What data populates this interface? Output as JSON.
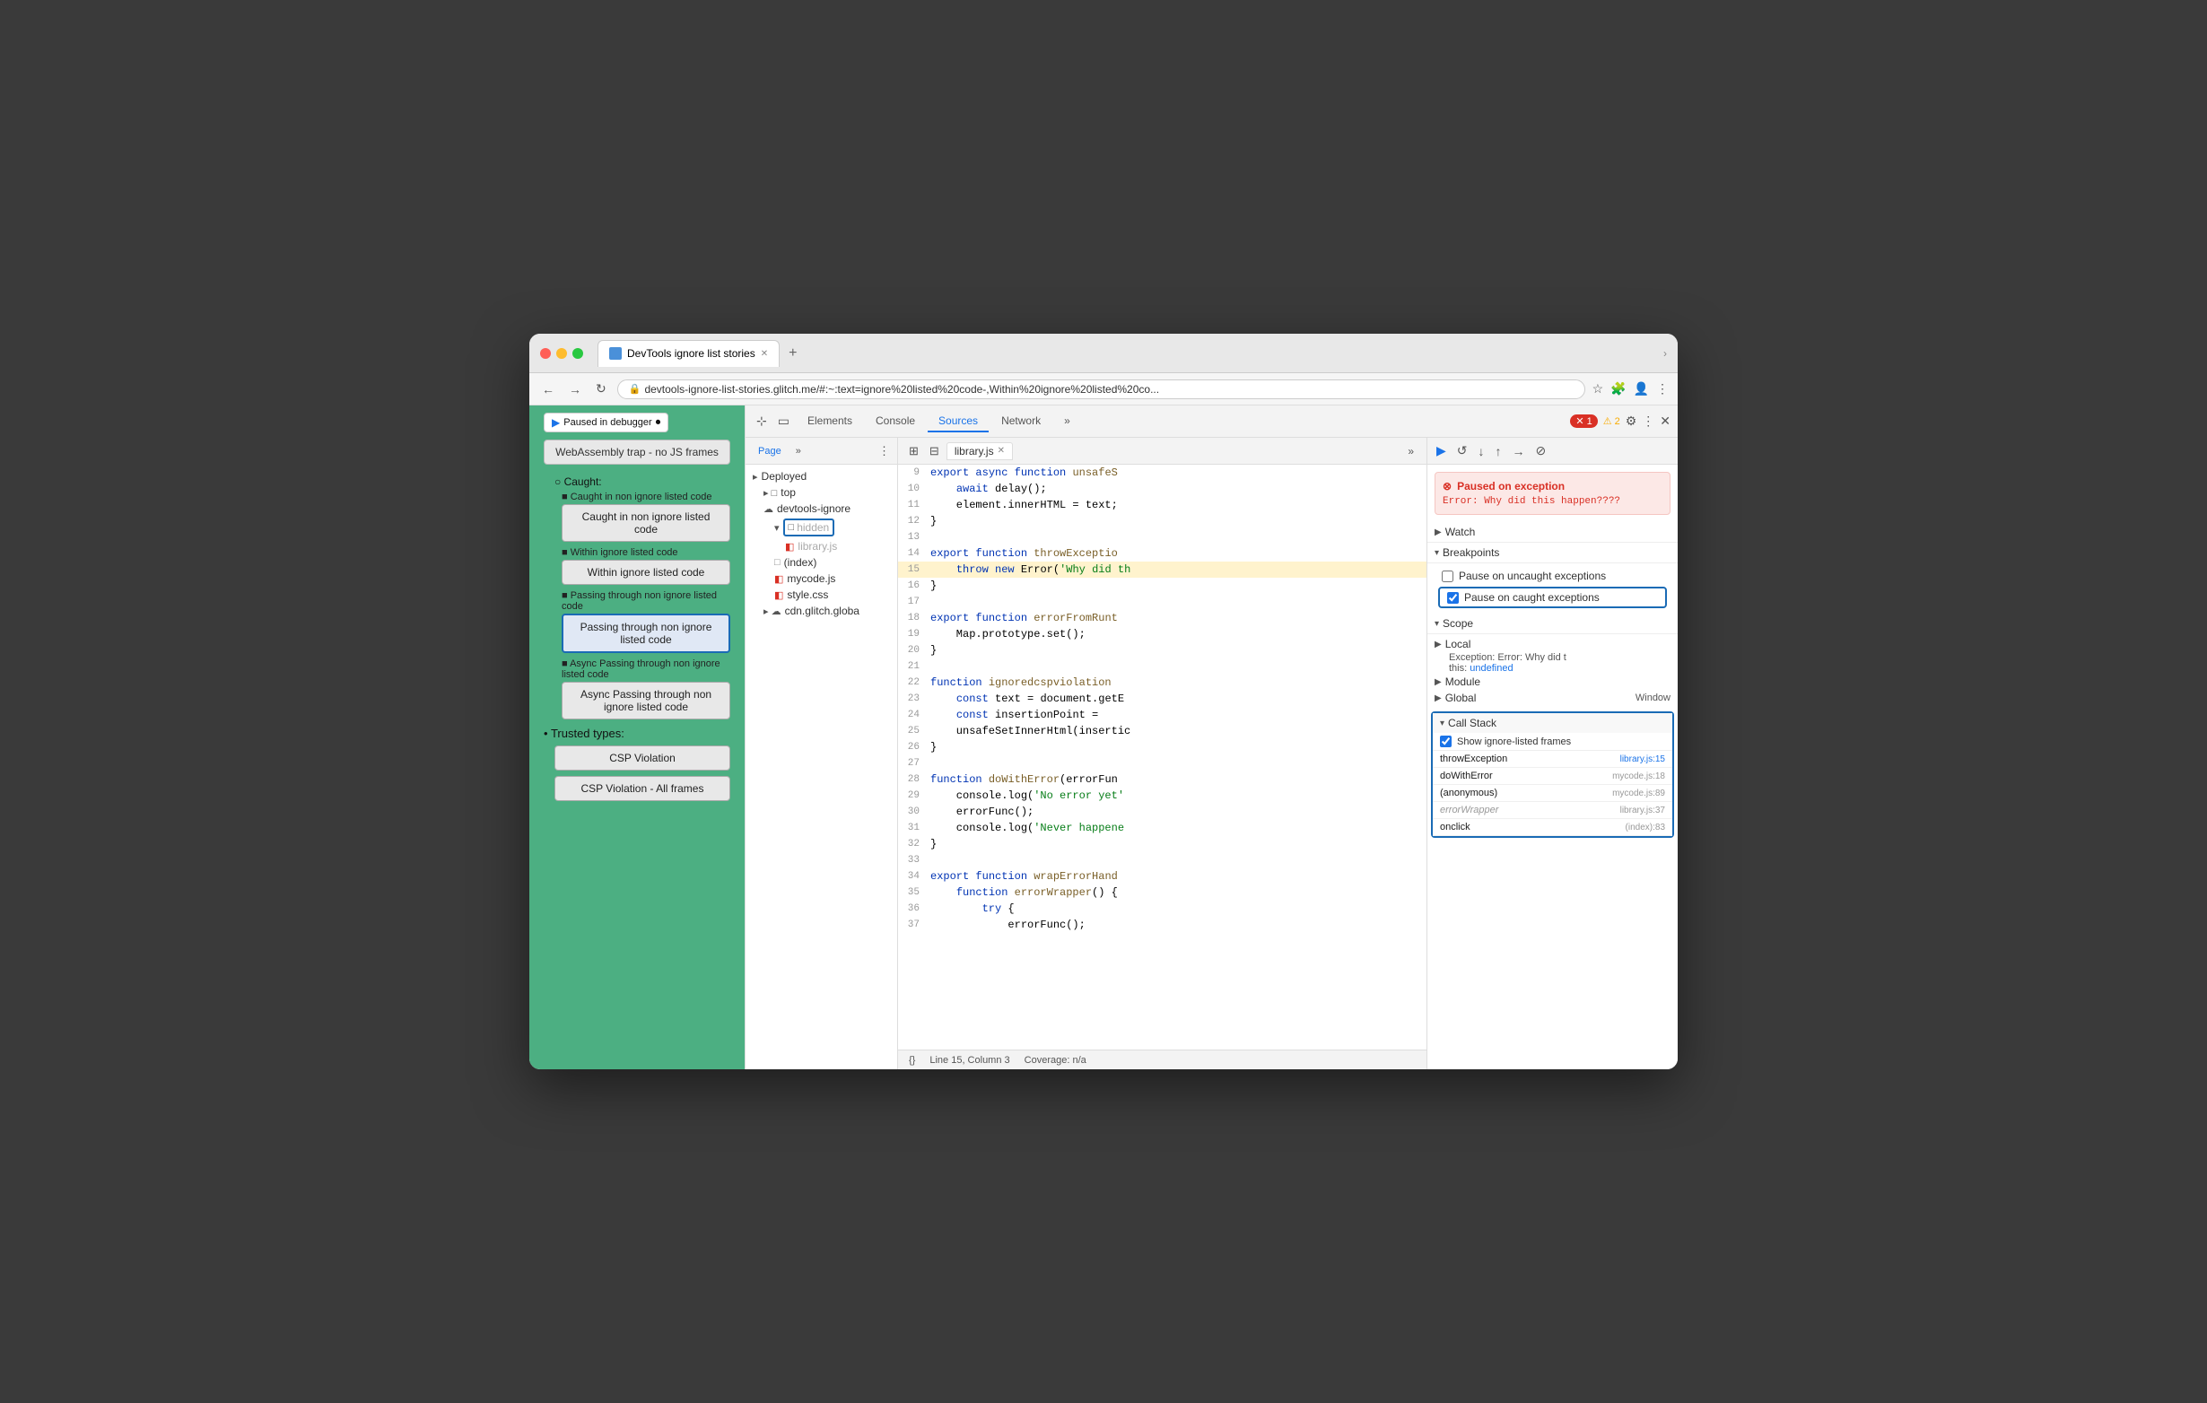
{
  "browser": {
    "tab_title": "DevTools ignore list stories",
    "url": "devtools-ignore-list-stories.glitch.me/#:~:text=ignore%20listed%20code-,Within%20ignore%20listed%20co...",
    "new_tab_icon": "+",
    "chevron_icon": "›"
  },
  "page_content": {
    "paused_label": "Paused in debugger",
    "webassembly_box": "WebAssembly trap - no JS frames",
    "caught_section_title": "Caught:",
    "items": [
      {
        "bullet": "■",
        "label": "Caught in non ignore listed code",
        "box_label": "Caught in non ignore listed code",
        "highlighted": false
      },
      {
        "bullet": "■",
        "label": "Within ignore listed code",
        "box_label": "Within ignore listed code",
        "highlighted": false
      },
      {
        "bullet": "■",
        "label": "Passing through non ignore listed code",
        "box_label": "Passing through non ignore listed code",
        "highlighted": true
      },
      {
        "bullet": "■",
        "label": "Async Passing through non ignore listed code",
        "box_label": "Async Passing through non ignore listed code",
        "highlighted": false
      }
    ],
    "trusted_types_title": "Trusted types:",
    "csp_violation": "CSP Violation",
    "csp_violation_all": "CSP Violation - All frames"
  },
  "devtools": {
    "toolbar_icons": [
      "⊞",
      "□"
    ],
    "tabs": [
      "Elements",
      "Console",
      "Sources",
      "Network",
      "»"
    ],
    "active_tab": "Sources",
    "error_count": "1",
    "warning_count": "2",
    "settings_icon": "⚙",
    "more_icon": "⋮",
    "close_icon": "✕"
  },
  "sources": {
    "sidebar_tabs": [
      "Page",
      "»"
    ],
    "more_icon": "⋮",
    "tree": [
      {
        "label": "Deployed",
        "indent": 0,
        "icon": "folder"
      },
      {
        "label": "top",
        "indent": 1,
        "icon": "folder"
      },
      {
        "label": "devtools-ignore",
        "indent": 1,
        "icon": "cloud"
      },
      {
        "label": "hidden",
        "indent": 2,
        "icon": "folder-highlighted",
        "grayed": true
      },
      {
        "label": "library.js",
        "indent": 3,
        "icon": "file-red",
        "grayed": true
      },
      {
        "label": "(index)",
        "indent": 2,
        "icon": "file-gray"
      },
      {
        "label": "mycode.js",
        "indent": 2,
        "icon": "file-red"
      },
      {
        "label": "style.css",
        "indent": 2,
        "icon": "file-red"
      },
      {
        "label": "cdn.glitch.globa",
        "indent": 1,
        "icon": "cloud"
      }
    ]
  },
  "editor": {
    "active_file": "library.js",
    "close_icon": "✕",
    "nav_icons": [
      "⊞",
      "«",
      "»"
    ],
    "lines": [
      {
        "num": 9,
        "content": "export async function unsafeS",
        "highlight": false
      },
      {
        "num": 10,
        "content": "    await delay();",
        "highlight": false
      },
      {
        "num": 11,
        "content": "    element.innerHTML = text;",
        "highlight": false
      },
      {
        "num": 12,
        "content": "}",
        "highlight": false
      },
      {
        "num": 13,
        "content": "",
        "highlight": false
      },
      {
        "num": 14,
        "content": "export function throwExceptio",
        "highlight": false
      },
      {
        "num": 15,
        "content": "    throw new Error('Why did th",
        "highlight": true
      },
      {
        "num": 16,
        "content": "}",
        "highlight": false
      },
      {
        "num": 17,
        "content": "",
        "highlight": false
      },
      {
        "num": 18,
        "content": "export function errorFromRunt",
        "highlight": false
      },
      {
        "num": 19,
        "content": "    Map.prototype.set();",
        "highlight": false
      },
      {
        "num": 20,
        "content": "}",
        "highlight": false
      },
      {
        "num": 21,
        "content": "",
        "highlight": false
      },
      {
        "num": 22,
        "content": "function ignoredcspviolation",
        "highlight": false
      },
      {
        "num": 23,
        "content": "    const text = document.getE",
        "highlight": false
      },
      {
        "num": 24,
        "content": "    const insertionPoint =",
        "highlight": false
      },
      {
        "num": 25,
        "content": "    unsafeSetInnerHtml(insertic",
        "highlight": false
      },
      {
        "num": 26,
        "content": "}",
        "highlight": false
      },
      {
        "num": 27,
        "content": "",
        "highlight": false
      },
      {
        "num": 28,
        "content": "function doWithError(errorFun",
        "highlight": false
      },
      {
        "num": 29,
        "content": "    console.log('No error yet'",
        "highlight": false
      },
      {
        "num": 30,
        "content": "    errorFunc();",
        "highlight": false
      },
      {
        "num": 31,
        "content": "    console.log('Never happene",
        "highlight": false
      },
      {
        "num": 32,
        "content": "}",
        "highlight": false
      },
      {
        "num": 33,
        "content": "",
        "highlight": false
      },
      {
        "num": 34,
        "content": "export function wrapErrorHand",
        "highlight": false
      },
      {
        "num": 35,
        "content": "    function errorWrapper() {",
        "highlight": false
      },
      {
        "num": 36,
        "content": "        try {",
        "highlight": false
      },
      {
        "num": 37,
        "content": "            errorFunc();",
        "highlight": false
      }
    ],
    "statusbar": {
      "line_col": "Line 15, Column 3",
      "coverage": "Coverage: n/a"
    }
  },
  "right_panel": {
    "debug_buttons": [
      "▶",
      "↺",
      "↓",
      "↑",
      "→",
      "⊘"
    ],
    "exception_panel": {
      "title": "Paused on exception",
      "message": "Error: Why did this\nhappen????"
    },
    "watch": {
      "label": "Watch"
    },
    "breakpoints": {
      "label": "Breakpoints",
      "uncaught_label": "Pause on uncaught exceptions",
      "caught_label": "Pause on caught exceptions",
      "uncaught_checked": false,
      "caught_checked": true
    },
    "scope": {
      "label": "Scope",
      "local_label": "Local",
      "exception_label": "Exception: Error: Why did t",
      "this_label": "this:",
      "this_val": "undefined",
      "module_label": "Module",
      "global_label": "Global",
      "global_val": "Window"
    },
    "call_stack": {
      "label": "Call Stack",
      "show_ignore_label": "Show ignore-listed frames",
      "show_ignore_checked": true,
      "items": [
        {
          "fn": "throwException",
          "loc": "library.js:15",
          "grayed": false,
          "arrow": true
        },
        {
          "fn": "doWithError",
          "loc": "mycode.js:18",
          "grayed": false,
          "arrow": false
        },
        {
          "fn": "(anonymous)",
          "loc": "mycode.js:89",
          "grayed": false,
          "arrow": false
        },
        {
          "fn": "errorWrapper",
          "loc": "library.js:37",
          "grayed": true,
          "arrow": false
        },
        {
          "fn": "onclick",
          "loc": "(index):83",
          "grayed": false,
          "arrow": false
        }
      ]
    }
  }
}
